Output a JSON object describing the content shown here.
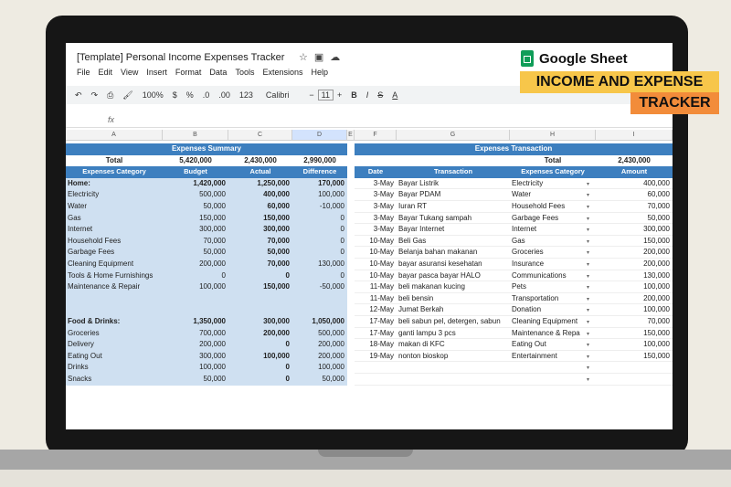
{
  "window": {
    "title": "[Template] Personal Income Expenses Tracker",
    "menu": [
      "File",
      "Edit",
      "View",
      "Insert",
      "Format",
      "Data",
      "Tools",
      "Extensions",
      "Help"
    ]
  },
  "toolbar": {
    "zoom": "100%",
    "currency": "$",
    "percent": "%",
    "dec_less": ".0",
    "dec_more": ".00",
    "num_format": "123",
    "font": "Calibri",
    "font_size": "11",
    "bold": "B",
    "italic": "I",
    "strike": "S",
    "text_color": "A",
    "fx": "fx"
  },
  "badges": {
    "google_sheet": "Google Sheet",
    "income_expense": "INCOME AND EXPENSE",
    "tracker": "TRACKER"
  },
  "columns": [
    "A",
    "B",
    "C",
    "D",
    "E",
    "F",
    "G",
    "H",
    "I"
  ],
  "summary": {
    "title": "Expenses Summary",
    "total_label": "Total",
    "total_budget": "5,420,000",
    "total_actual": "2,430,000",
    "total_diff": "2,990,000",
    "headers": [
      "Expenses Category",
      "Budget",
      "Actual",
      "Difference"
    ],
    "rows": [
      [
        "Home:",
        "1,420,000",
        "1,250,000",
        "170,000"
      ],
      [
        "Electricity",
        "500,000",
        "400,000",
        "100,000"
      ],
      [
        "Water",
        "50,000",
        "60,000",
        "-10,000"
      ],
      [
        "Gas",
        "150,000",
        "150,000",
        "0"
      ],
      [
        "Internet",
        "300,000",
        "300,000",
        "0"
      ],
      [
        "Household Fees",
        "70,000",
        "70,000",
        "0"
      ],
      [
        "Garbage Fees",
        "50,000",
        "50,000",
        "0"
      ],
      [
        "Cleaning Equipment",
        "200,000",
        "70,000",
        "130,000"
      ],
      [
        "Tools & Home Furnishings",
        "0",
        "0",
        "0"
      ],
      [
        "Maintenance & Repair",
        "100,000",
        "150,000",
        "-50,000"
      ],
      [
        "",
        "",
        "",
        ""
      ],
      [
        "",
        "",
        "",
        ""
      ],
      [
        "Food & Drinks:",
        "1,350,000",
        "300,000",
        "1,050,000"
      ],
      [
        "Groceries",
        "700,000",
        "200,000",
        "500,000"
      ],
      [
        "Delivery",
        "200,000",
        "0",
        "200,000"
      ],
      [
        "Eating Out",
        "300,000",
        "100,000",
        "200,000"
      ],
      [
        "Drinks",
        "100,000",
        "0",
        "100,000"
      ],
      [
        "Snacks",
        "50,000",
        "0",
        "50,000"
      ]
    ]
  },
  "transactions": {
    "title": "Expenses Transaction",
    "total_label": "Total",
    "total_amount": "2,430,000",
    "headers": [
      "Date",
      "Transaction",
      "Expenses Category",
      "Amount"
    ],
    "rows": [
      [
        "3-May",
        "Bayar Listrik",
        "Electricity",
        "400,000"
      ],
      [
        "3-May",
        "Bayar PDAM",
        "Water",
        "60,000"
      ],
      [
        "3-May",
        "Iuran RT",
        "Household Fees",
        "70,000"
      ],
      [
        "3-May",
        "Bayar Tukang sampah",
        "Garbage Fees",
        "50,000"
      ],
      [
        "3-May",
        "Bayar Internet",
        "Internet",
        "300,000"
      ],
      [
        "10-May",
        "Beli Gas",
        "Gas",
        "150,000"
      ],
      [
        "10-May",
        "Belanja bahan makanan",
        "Groceries",
        "200,000"
      ],
      [
        "10-May",
        "bayar asuransi kesehatan",
        "Insurance",
        "200,000"
      ],
      [
        "10-May",
        "bayar pasca bayar HALO",
        "Communications",
        "130,000"
      ],
      [
        "11-May",
        "beli makanan kucing",
        "Pets",
        "100,000"
      ],
      [
        "11-May",
        "beli bensin",
        "Transportation",
        "200,000"
      ],
      [
        "12-May",
        "Jumat Berkah",
        "Donation",
        "100,000"
      ],
      [
        "17-May",
        "beli sabun pel, detergen, sabun",
        "Cleaning Equipment",
        "70,000"
      ],
      [
        "17-May",
        "ganti lampu 3 pcs",
        "Maintenance & Repa",
        "150,000"
      ],
      [
        "18-May",
        "makan di KFC",
        "Eating Out",
        "100,000"
      ],
      [
        "19-May",
        "nonton bioskop",
        "Entertainment",
        "150,000"
      ],
      [
        "",
        "",
        "",
        ""
      ],
      [
        "",
        "",
        "",
        ""
      ]
    ]
  }
}
